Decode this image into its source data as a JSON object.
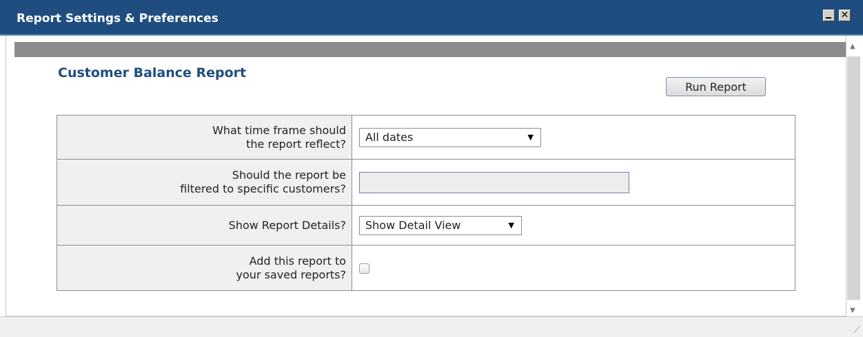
{
  "window": {
    "title": "Report Settings & Preferences"
  },
  "report": {
    "title": "Customer Balance Report",
    "run_label": "Run Report"
  },
  "form": {
    "timeframe": {
      "label_line1": "What time frame should",
      "label_line2": "the report reflect?",
      "value": "All dates"
    },
    "customers": {
      "label_line1": "Should the report be",
      "label_line2": "filtered to specific customers?",
      "value": ""
    },
    "details": {
      "label": "Show Report Details?",
      "value": "Show Detail View"
    },
    "save": {
      "label_line1": "Add this report to",
      "label_line2": "your saved reports?",
      "checked": false
    }
  },
  "icons": {
    "minimize": "minimize-icon",
    "close": "close-icon",
    "dropdown": "chevron-down-icon",
    "scroll_up": "scroll-up-icon",
    "scroll_down": "scroll-down-icon",
    "resize": "resize-grip-icon"
  },
  "colors": {
    "titlebar": "#1f4d80",
    "title_text": "#1f4d80",
    "label_bg": "#f0f0f0"
  }
}
